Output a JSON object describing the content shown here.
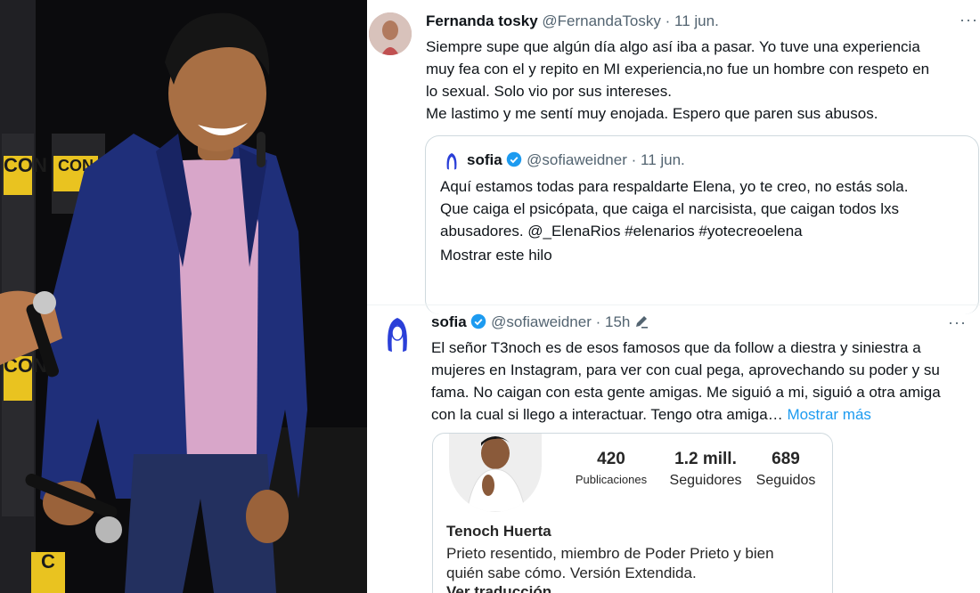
{
  "photo": {
    "banner_text_1": "COMIC CON",
    "banner_text_2": "CON"
  },
  "tweet1": {
    "name": "Fernanda tosky",
    "handle": "@FernandaTosky",
    "date": "11 jun.",
    "text": "Siempre supe que algún día algo así iba a pasar. Yo tuve una experiencia\nmuy fea con el y repito en MI experiencia,no fue un hombre con respeto en\nlo sexual. Solo vio por sus intereses.\nMe lastimo y me sentí muy enojada. Espero que paren sus abusos."
  },
  "quote": {
    "name": "sofia",
    "handle": "@sofiaweidner",
    "date": "11 jun.",
    "text": "Aquí estamos todas para respaldarte Elena, yo te creo, no estás sola.\nQue caiga el psicópata, que caiga el narcisista, que caigan todos lxs\nabusadores. @_ElenaRios #elenarios #yotecreoelena",
    "show_thread": "Mostrar este hilo"
  },
  "tweet2": {
    "name": "sofia",
    "handle": "@sofiaweidner",
    "date": "15h",
    "text": "El señor T3noch es de esos famosos que da follow a diestra y siniestra a\nmujeres en Instagram, para ver con cual pega, aprovechando su poder y su\nfama. No caigan con esta gente amigas. Me siguió a mi, siguió a otra amiga\ncon la cual si llego a interactuar. Tengo otra amiga…",
    "show_more": "Mostrar más"
  },
  "profile": {
    "posts_count": "420",
    "posts_label": "Publicaciones",
    "followers_count": "1.2 mill.",
    "followers_label": "Seguidores",
    "following_count": "689",
    "following_label": "Seguidos",
    "name": "Tenoch Huerta",
    "bio": "Prieto resentido, miembro de Poder Prieto y bien\nquién sabe cómo. Versión Extendida.",
    "translate": "Ver traducción"
  },
  "colors": {
    "accent": "#1d9bf0",
    "muted": "#536471",
    "blazer": "#1f2f7a",
    "shirt": "#d8a6c9"
  }
}
